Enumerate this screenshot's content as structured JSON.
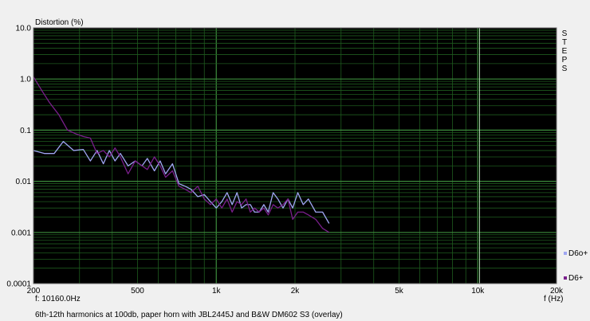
{
  "chart_data": {
    "type": "line",
    "ylabel": "Distortion (%)",
    "xlabel": "f (Hz)",
    "cursor_readout": "f: 10160.0Hz",
    "caption": "6th-12th harmonics at 100db, paper horn with JBL2445J and B&W DM602 S3 (overlay)",
    "side_label": "STEPS",
    "x_scale": "log",
    "y_scale": "log",
    "xlim": [
      200,
      20000
    ],
    "ylim": [
      0.0001,
      10
    ],
    "grid": true,
    "x_ticks": [
      {
        "value": 200,
        "label": "200"
      },
      {
        "value": 500,
        "label": "500"
      },
      {
        "value": 1000,
        "label": "1k"
      },
      {
        "value": 2000,
        "label": "2k"
      },
      {
        "value": 5000,
        "label": "5k"
      },
      {
        "value": 10000,
        "label": "10k"
      },
      {
        "value": 20000,
        "label": "20k"
      }
    ],
    "y_ticks": [
      {
        "value": 10,
        "label": "10.0"
      },
      {
        "value": 1,
        "label": "1.0"
      },
      {
        "value": 0.1,
        "label": "0.1"
      },
      {
        "value": 0.01,
        "label": "0.01"
      },
      {
        "value": 0.001,
        "label": "0.001"
      },
      {
        "value": 0.0001,
        "label": "0.0001"
      }
    ],
    "cursor_x": 10160,
    "colors": {
      "background": "#000000",
      "grid_major": "#3c8c3c",
      "grid_minor": "#1e5a1e",
      "cursor": "#b0d0b0"
    },
    "series": [
      {
        "name": "D6o+",
        "color": "#9fa6f2",
        "x": [
          200,
          220,
          240,
          260,
          285,
          310,
          330,
          350,
          370,
          390,
          410,
          430,
          460,
          490,
          520,
          545,
          580,
          610,
          640,
          680,
          720,
          760,
          800,
          850,
          900,
          950,
          1000,
          1050,
          1100,
          1150,
          1200,
          1250,
          1300,
          1350,
          1400,
          1460,
          1520,
          1580,
          1650,
          1720,
          1800,
          1880,
          1960,
          2050,
          2150,
          2250,
          2400,
          2550,
          2700
        ],
        "y": [
          0.04,
          0.035,
          0.035,
          0.06,
          0.04,
          0.042,
          0.025,
          0.04,
          0.022,
          0.04,
          0.025,
          0.035,
          0.02,
          0.025,
          0.02,
          0.028,
          0.016,
          0.025,
          0.014,
          0.022,
          0.009,
          0.008,
          0.007,
          0.005,
          0.0055,
          0.004,
          0.003,
          0.004,
          0.006,
          0.0035,
          0.006,
          0.003,
          0.0035,
          0.0035,
          0.0025,
          0.0025,
          0.0035,
          0.0025,
          0.006,
          0.0045,
          0.003,
          0.0045,
          0.003,
          0.006,
          0.0035,
          0.0045,
          0.0025,
          0.0025,
          0.0015
        ]
      },
      {
        "name": "D6+",
        "color": "#7a1f8c",
        "x": [
          200,
          215,
          230,
          250,
          270,
          290,
          310,
          330,
          350,
          370,
          390,
          410,
          430,
          460,
          490,
          520,
          545,
          580,
          610,
          640,
          680,
          720,
          760,
          800,
          850,
          900,
          950,
          1000,
          1050,
          1100,
          1150,
          1200,
          1250,
          1300,
          1350,
          1400,
          1460,
          1520,
          1580,
          1650,
          1720,
          1800,
          1880,
          1960,
          2050,
          2150,
          2250,
          2400,
          2550,
          2700
        ],
        "y": [
          1.1,
          0.6,
          0.35,
          0.2,
          0.1,
          0.085,
          0.075,
          0.07,
          0.035,
          0.04,
          0.03,
          0.045,
          0.03,
          0.014,
          0.025,
          0.02,
          0.017,
          0.03,
          0.02,
          0.012,
          0.016,
          0.008,
          0.007,
          0.006,
          0.008,
          0.0045,
          0.0035,
          0.0045,
          0.003,
          0.0045,
          0.0025,
          0.004,
          0.0035,
          0.0045,
          0.0025,
          0.003,
          0.0025,
          0.003,
          0.0022,
          0.0035,
          0.003,
          0.0035,
          0.0045,
          0.0018,
          0.0025,
          0.0025,
          0.0022,
          0.0018,
          0.0012,
          0.001
        ]
      }
    ]
  }
}
